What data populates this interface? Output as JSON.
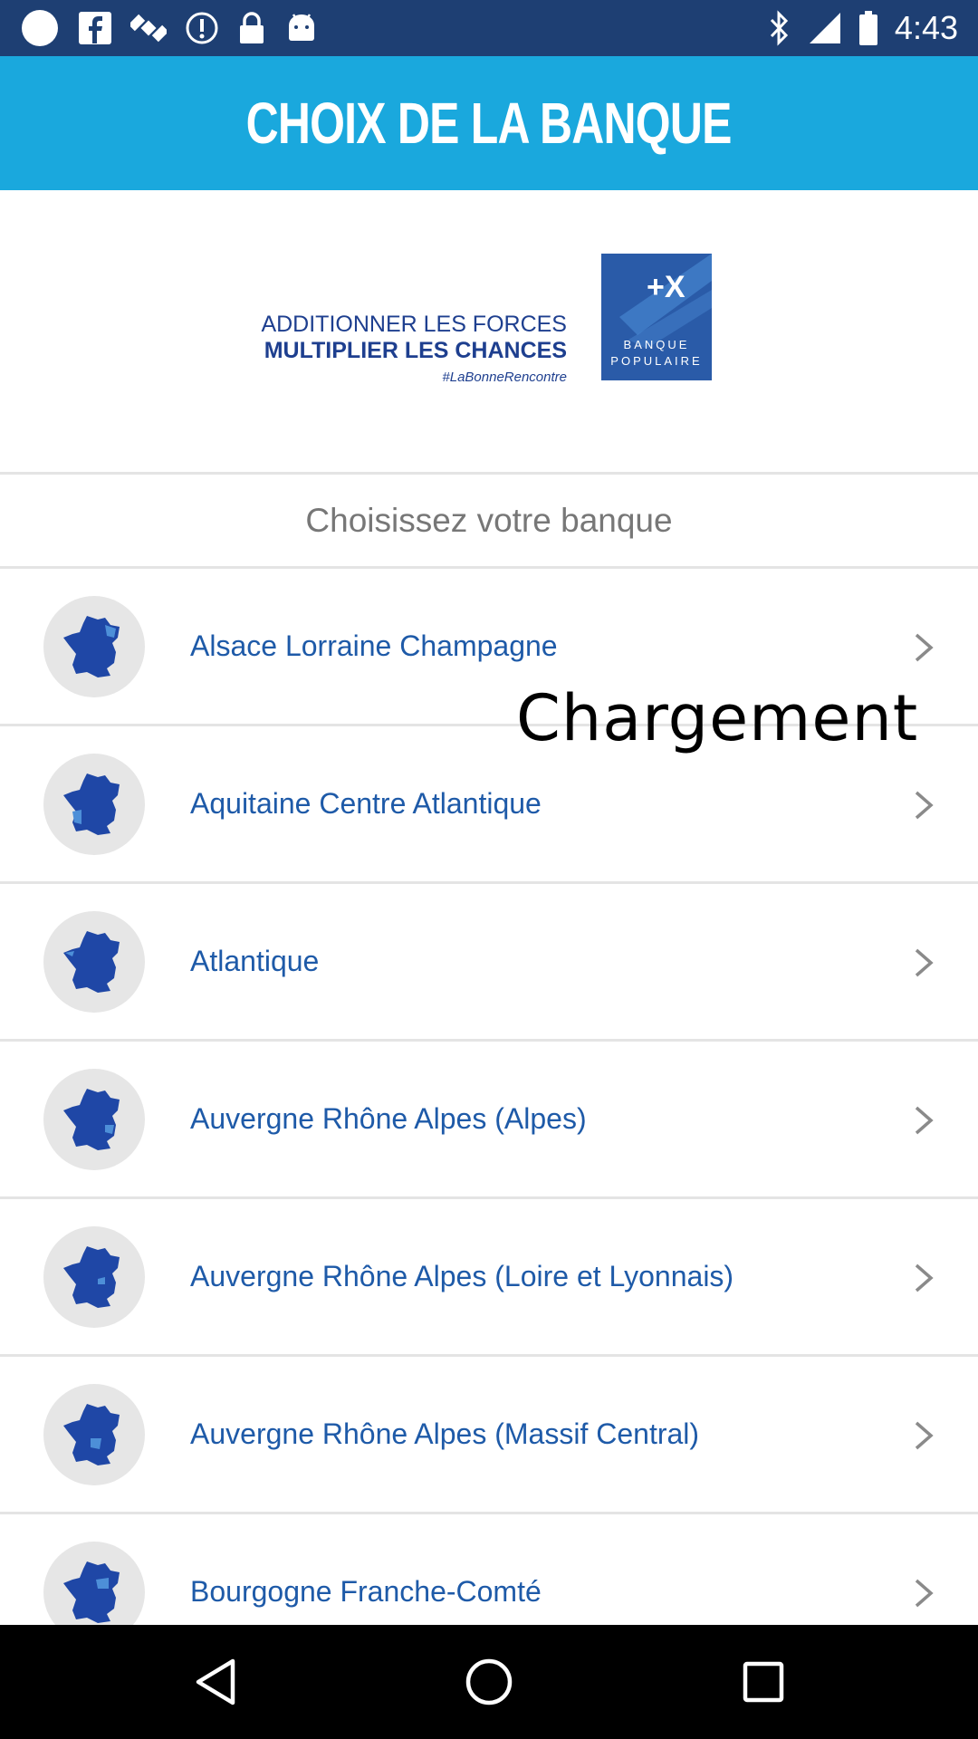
{
  "status_bar": {
    "time": "4:43",
    "left_icons": [
      "circle-notification-icon",
      "facebook-icon",
      "satellite-icon",
      "info-icon",
      "lock-icon",
      "android-icon"
    ],
    "right_icons": [
      "bluetooth-icon",
      "signal-icon",
      "battery-icon"
    ]
  },
  "header": {
    "title": "CHOIX DE LA BANQUE",
    "background": "#1aa8dd"
  },
  "banner": {
    "line1": "ADDITIONNER LES FORCES",
    "line2": "MULTIPLIER LES CHANCES",
    "hashtag": "#LaBonneRencontre",
    "logo_symbol": "+X",
    "logo_line1": "BANQUE",
    "logo_line2": "POPULAIRE",
    "logo_color": "#2a5ba8"
  },
  "section": {
    "title": "Choisissez votre banque"
  },
  "banks": [
    {
      "label": "Alsace Lorraine Champagne",
      "icon": "france-map-icon"
    },
    {
      "label": "Aquitaine Centre Atlantique",
      "icon": "france-map-icon"
    },
    {
      "label": "Atlantique",
      "icon": "france-map-icon"
    },
    {
      "label": "Auvergne Rhône Alpes (Alpes)",
      "icon": "france-map-icon"
    },
    {
      "label": "Auvergne Rhône Alpes (Loire et Lyonnais)",
      "icon": "france-map-icon"
    },
    {
      "label": "Auvergne Rhône Alpes (Massif Central)",
      "icon": "france-map-icon"
    },
    {
      "label": "Bourgogne Franche-Comté",
      "icon": "france-map-icon"
    }
  ],
  "loading": {
    "text": "Chargement"
  },
  "nav": {
    "buttons": [
      "back-icon",
      "home-icon",
      "recents-icon"
    ]
  },
  "colors": {
    "status_bar": "#1e3f73",
    "list_text": "#1e5aa8",
    "map": "#1f47a6",
    "map_highlight": "#4d8fd8"
  }
}
